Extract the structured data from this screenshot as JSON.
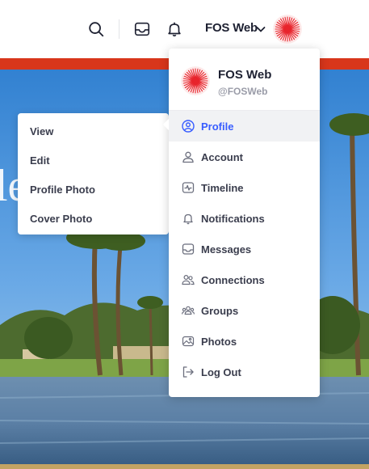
{
  "header": {
    "user_name": "FOS Web",
    "icons": [
      "search-icon",
      "inbox-icon",
      "bell-icon",
      "chevron-down-icon"
    ]
  },
  "profile_card": {
    "name": "FOS Web",
    "handle": "@FOSWeb"
  },
  "dropdown": {
    "items": [
      {
        "label": "Profile",
        "icon": "user-circle-icon",
        "active": true
      },
      {
        "label": "Account",
        "icon": "user-icon"
      },
      {
        "label": "Timeline",
        "icon": "activity-icon"
      },
      {
        "label": "Notifications",
        "icon": "bell-icon"
      },
      {
        "label": "Messages",
        "icon": "inbox-icon"
      },
      {
        "label": "Connections",
        "icon": "users-icon"
      },
      {
        "label": "Groups",
        "icon": "group-icon"
      },
      {
        "label": "Photos",
        "icon": "images-icon"
      },
      {
        "label": "Log Out",
        "icon": "logout-icon"
      }
    ]
  },
  "submenu": {
    "items": [
      {
        "label": "View"
      },
      {
        "label": "Edit"
      },
      {
        "label": "Profile Photo"
      },
      {
        "label": "Cover Photo"
      }
    ]
  },
  "colors": {
    "accent": "#385dff",
    "banner_red": "#d8361b",
    "avatar_red": "#e8242c"
  }
}
